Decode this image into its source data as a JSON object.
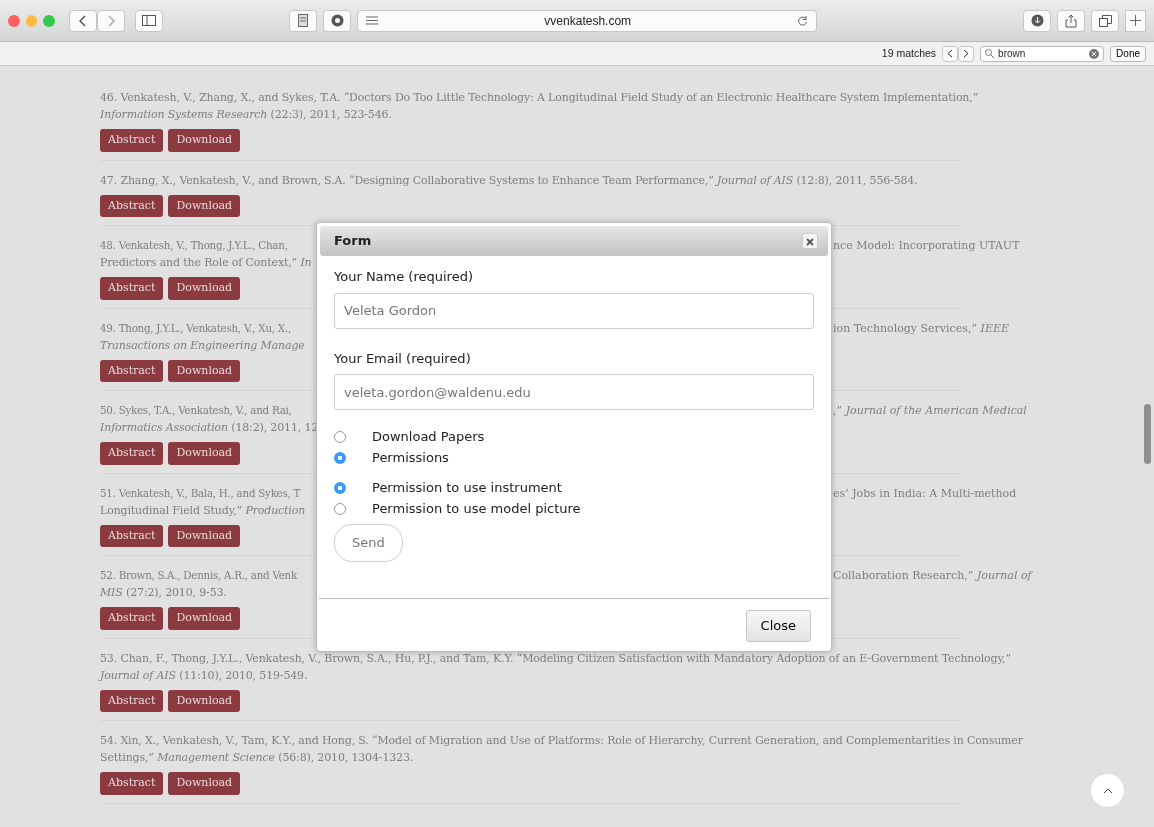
{
  "browser": {
    "url": "vvenkatesh.com",
    "find_bar": {
      "matches": "19 matches",
      "query": "brown",
      "done": "Done"
    }
  },
  "publications": [
    {
      "lines": [
        {
          "text": "46. Venkatesh, V., Zhang, X., and Sykes, T.A. “Doctors Do Too Little Technology: A Longitudinal Field Study of an Electronic Healthcare System Implementation,”"
        },
        {
          "text": "*Information Systems Research* (22:3), 2011, 523-546."
        }
      ],
      "buttons": [
        "Abstract",
        "Download"
      ]
    },
    {
      "lines": [
        {
          "text": "47. Zhang, X., Venkatesh, V., and Brown, S.A. “Designing Collaborative Systems to Enhance Team Performance,” *Journal of AIS* (12:8), 2011, 556-584."
        }
      ],
      "buttons": [
        "Abstract",
        "Download"
      ]
    },
    {
      "lines": [
        {
          "text": "48. Venkatesh, V., Thong, J.Y.L., Chan,",
          "right": "nce Model: Incorporating UTAUT"
        },
        {
          "text": "Predictors and the Role of Context,” *In*"
        }
      ],
      "buttons": [
        "Abstract",
        "Download"
      ]
    },
    {
      "lines": [
        {
          "text": "49. Thong, J.Y.L., Venkatesh, V., Xu, X.,",
          "right": "ion Technology Services,” *IEEE*"
        },
        {
          "text": "*Transactions on Engineering Manage*"
        }
      ],
      "buttons": [
        "Abstract",
        "Download"
      ]
    },
    {
      "lines": [
        {
          "text": "50. Sykes, T.A., Venkatesh, V., and Rai,",
          "right": ",” *Journal of the American Medical*"
        },
        {
          "text": "*Informatics Association* (18:2), 2011, 12"
        }
      ],
      "buttons": [
        "Abstract",
        "Download"
      ]
    },
    {
      "lines": [
        {
          "text": "51. Venkatesh, V., Bala, H., and Sykes, T",
          "right": "es’ Jobs in India: A Multi-method"
        },
        {
          "text": "Longitudinal Field Study,” *Production*"
        }
      ],
      "buttons": [
        "Abstract",
        "Download"
      ]
    },
    {
      "lines": [
        {
          "text": "52. Brown, S.A., Dennis, A.R., and Venk",
          "right": "Collaboration Research,” *Journal of*"
        },
        {
          "text": "*MIS* (27:2), 2010, 9-53."
        }
      ],
      "buttons": [
        "Abstract",
        "Download"
      ]
    },
    {
      "lines": [
        {
          "text": "53. Chan, F., Thong, J.Y.L., Venkatesh, V., Brown, S.A., Hu, P.J., and Tam, K.Y. “Modeling Citizen Satisfaction with Mandatory Adoption of an E-Government Technology,”"
        },
        {
          "text": "*Journal of AIS* (11:10), 2010, 519-549."
        }
      ],
      "buttons": [
        "Abstract",
        "Download"
      ]
    },
    {
      "lines": [
        {
          "text": "54. Xin, X., Venkatesh, V., Tam, K.Y., and Hong, S. “Model of Migration and Use of Platforms: Role of Hierarchy, Current Generation, and Complementarities in Consumer"
        },
        {
          "text": "Settings,” *Management Science* (56:8), 2010, 1304-1323."
        }
      ],
      "buttons": [
        "Abstract",
        "Download"
      ]
    }
  ],
  "modal": {
    "title": "Form",
    "fields": [
      {
        "label": "Your Name (required)",
        "value": "Veleta Gordon"
      },
      {
        "label": "Your Email (required)",
        "value": "veleta.gordon@waldenu.edu"
      }
    ],
    "request_types": [
      {
        "label": "Download Papers",
        "selected": false
      },
      {
        "label": "Permissions",
        "selected": true
      }
    ],
    "permission_types": [
      {
        "label": "Permission to use instrument",
        "selected": true
      },
      {
        "label": "Permission to use model picture",
        "selected": false
      }
    ],
    "send": "Send",
    "close": "Close"
  }
}
